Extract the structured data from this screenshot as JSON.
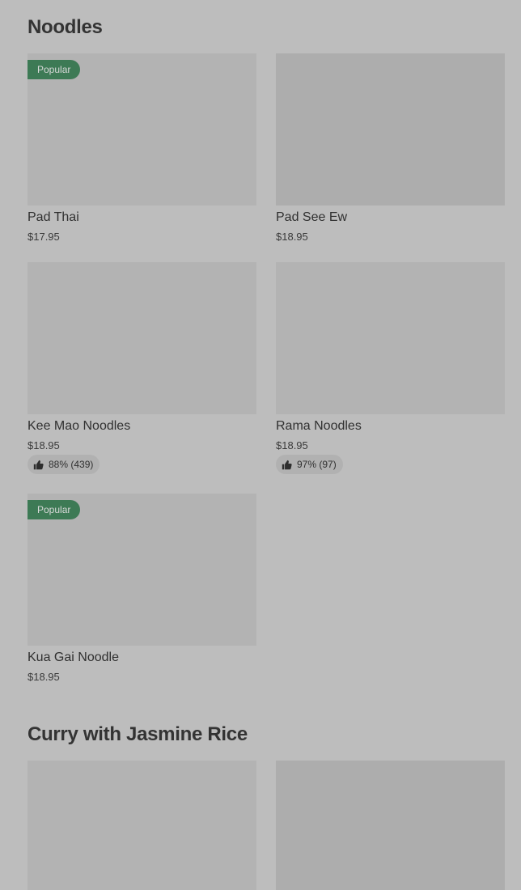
{
  "sections": [
    {
      "title": "Noodles",
      "items": [
        {
          "name": "Pad Thai",
          "price": "$17.95",
          "badge": "Popular"
        },
        {
          "name": "Pad See Ew",
          "price": "$18.95"
        },
        {
          "name": "Kee Mao Noodles",
          "price": "$18.95",
          "rating": "88% (439)"
        },
        {
          "name": "Rama Noodles",
          "price": "$18.95",
          "rating": "97% (97)"
        },
        {
          "name": "Kua Gai Noodle",
          "price": "$18.95",
          "badge": "Popular"
        }
      ]
    },
    {
      "title": "Curry with Jasmine Rice",
      "items": [
        {
          "name": "",
          "price": ""
        },
        {
          "name": "",
          "price": ""
        }
      ]
    }
  ],
  "icons": {
    "rating": "thumbs-up-icon"
  },
  "colors": {
    "badge": "#3d7a55",
    "background": "#bdbdbd"
  }
}
